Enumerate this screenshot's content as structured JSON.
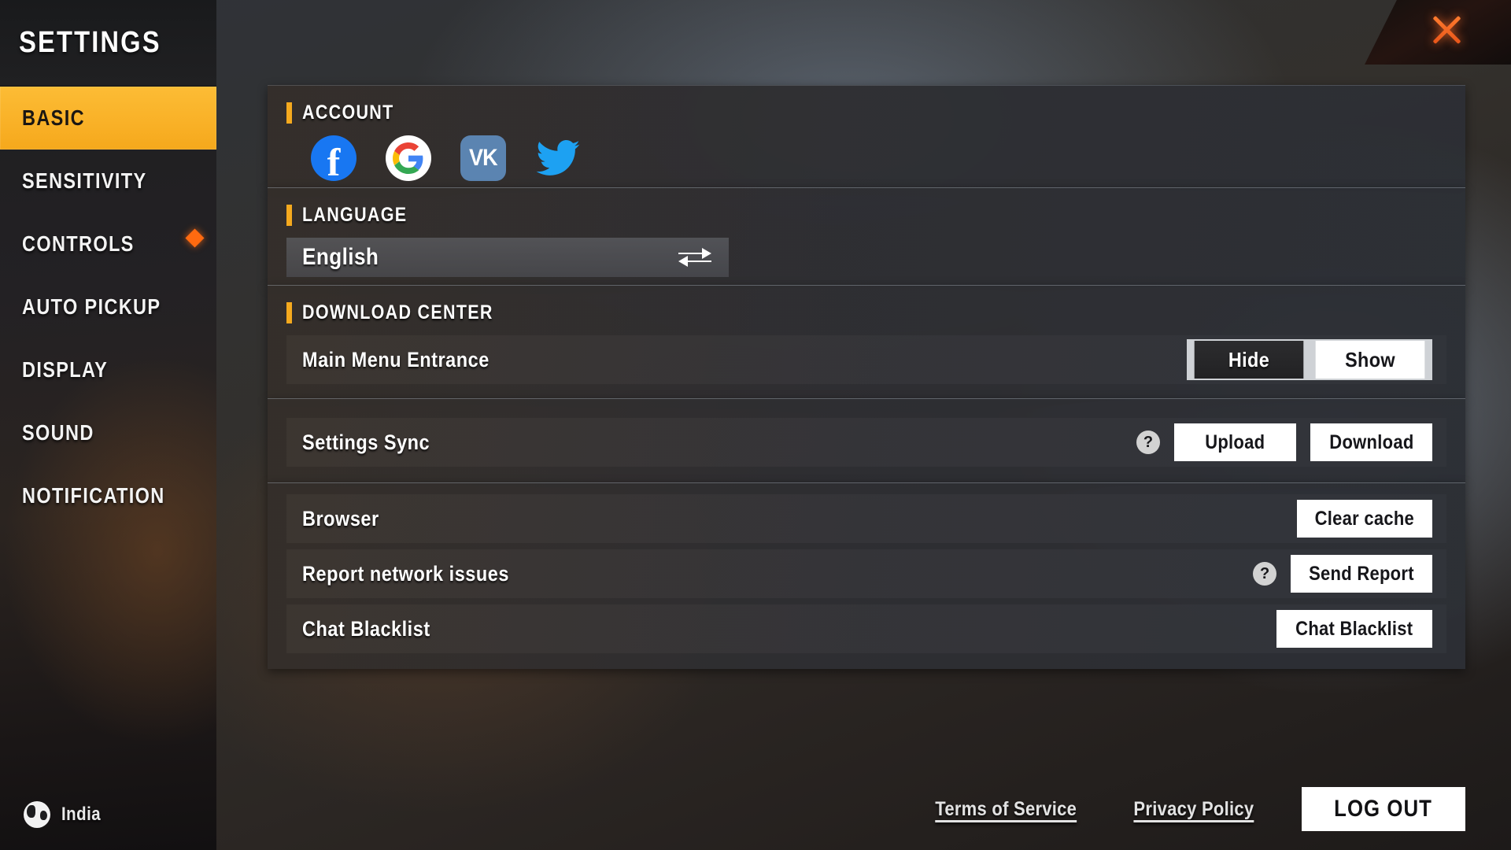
{
  "sidebar": {
    "title": "SETTINGS",
    "items": [
      {
        "label": "BASIC",
        "active": true,
        "badge": false
      },
      {
        "label": "SENSITIVITY",
        "active": false,
        "badge": false
      },
      {
        "label": "CONTROLS",
        "active": false,
        "badge": true
      },
      {
        "label": "AUTO PICKUP",
        "active": false,
        "badge": false
      },
      {
        "label": "DISPLAY",
        "active": false,
        "badge": false
      },
      {
        "label": "SOUND",
        "active": false,
        "badge": false
      },
      {
        "label": "NOTIFICATION",
        "active": false,
        "badge": false
      }
    ],
    "region": {
      "label": "India",
      "icon": "globe-icon"
    }
  },
  "window": {
    "close_icon": "close-icon",
    "accent_color": "#f5a91e",
    "close_color": "#ff6a10",
    "active_nav_color": "#f9b127"
  },
  "account": {
    "title": "ACCOUNT",
    "providers": [
      {
        "name": "Facebook",
        "icon": "facebook-icon",
        "color": "#1877f2"
      },
      {
        "name": "Google",
        "icon": "google-icon",
        "color": "#ffffff"
      },
      {
        "name": "VK",
        "icon": "vk-icon",
        "color": "#5b84b1",
        "label": "VK"
      },
      {
        "name": "Twitter",
        "icon": "twitter-icon",
        "color": "#1da1f2"
      }
    ]
  },
  "language": {
    "title": "LANGUAGE",
    "selected": "English",
    "swap_icon": "swap-arrows-icon"
  },
  "download_center": {
    "title": "DOWNLOAD CENTER",
    "main_menu_entrance": {
      "label": "Main Menu Entrance",
      "options": [
        {
          "label": "Hide",
          "selected": false
        },
        {
          "label": "Show",
          "selected": true
        }
      ]
    },
    "settings_sync": {
      "label": "Settings Sync",
      "help_icon": "question-mark-icon",
      "help_glyph": "?",
      "upload_label": "Upload",
      "download_label": "Download"
    }
  },
  "misc": {
    "browser": {
      "label": "Browser",
      "action_label": "Clear cache"
    },
    "report_network": {
      "label": "Report network issues",
      "help_icon": "question-mark-icon",
      "help_glyph": "?",
      "action_label": "Send Report"
    },
    "chat_blacklist": {
      "label": "Chat Blacklist",
      "action_label": "Chat Blacklist"
    }
  },
  "footer": {
    "terms_label": "Terms of Service",
    "privacy_label": "Privacy Policy",
    "logout_label": "LOG OUT"
  }
}
